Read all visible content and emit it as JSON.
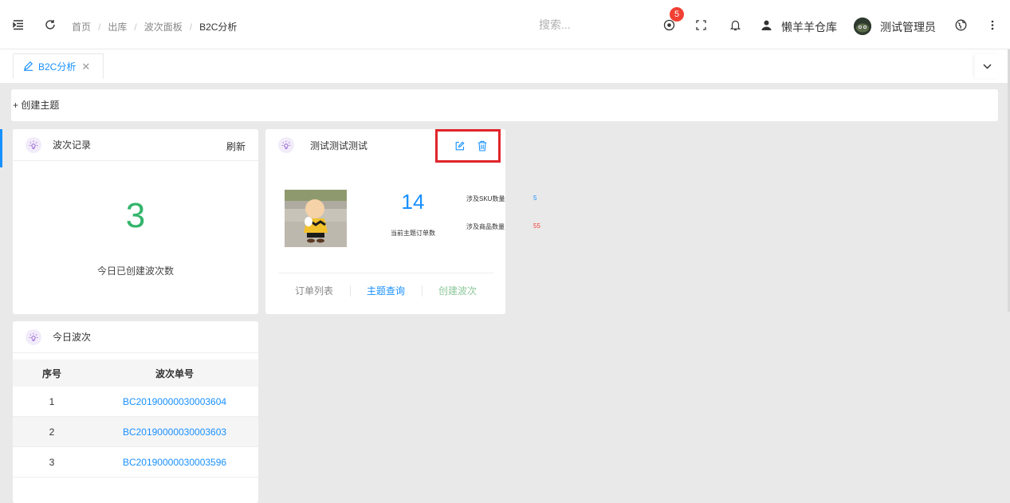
{
  "header": {
    "breadcrumb": [
      "首页",
      "出库",
      "波次面板",
      "B2C分析"
    ],
    "search_placeholder": "搜索...",
    "notification_count": "5",
    "warehouse": "懒羊羊仓库",
    "user": "测试管理员"
  },
  "tabs": [
    {
      "label": "B2C分析",
      "close": "✕"
    }
  ],
  "toolbar": {
    "create_theme": "+ 创建主题"
  },
  "wave_record": {
    "title": "波次记录",
    "refresh": "刷新",
    "count": "3",
    "count_label": "今日已创建波次数"
  },
  "today_waves": {
    "title": "今日波次",
    "columns": [
      "序号",
      "波次单号"
    ],
    "rows": [
      {
        "no": "1",
        "code": "BC20190000030003604"
      },
      {
        "no": "2",
        "code": "BC20190000030003603"
      },
      {
        "no": "3",
        "code": "BC20190000030003596"
      }
    ]
  },
  "theme_card": {
    "title": "测试测试测试",
    "order_count": "14",
    "order_count_label": "当前主题订单数",
    "sku_label": "涉及SKU数量",
    "sku_value": "5",
    "goods_label": "涉及商品数量",
    "goods_value": "55",
    "actions": [
      "订单列表",
      "主题查询",
      "创建波次"
    ]
  },
  "colors": {
    "accent": "#1890ff",
    "success": "#33b56b",
    "danger": "#f04134",
    "highlight": "#e0252b",
    "muted_green": "#8cc79a"
  }
}
